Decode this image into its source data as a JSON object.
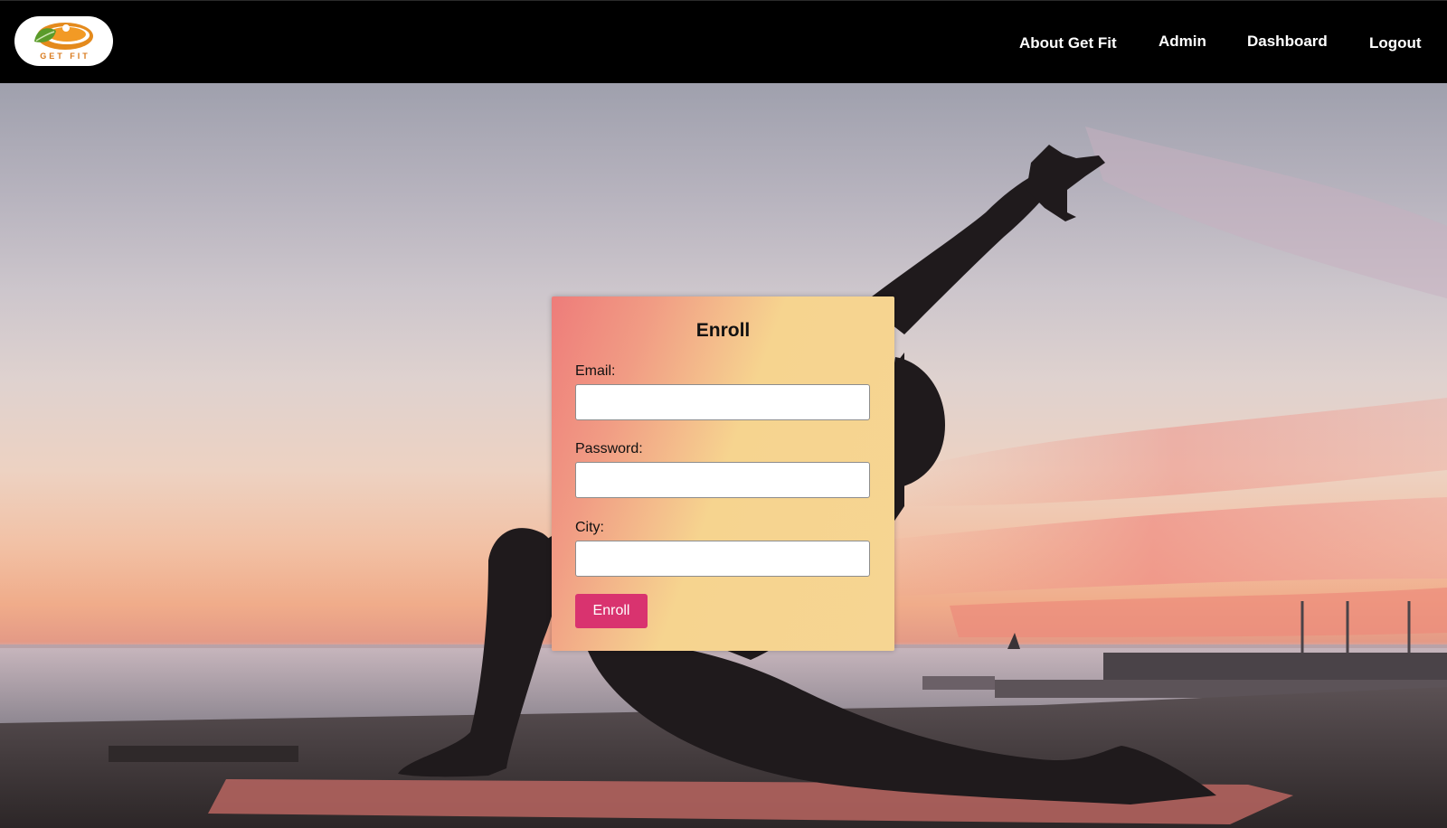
{
  "header": {
    "logo_text": "GET FIT",
    "nav": [
      {
        "label": "About Get Fit"
      },
      {
        "label": "Admin"
      },
      {
        "label": "Dashboard"
      },
      {
        "label": "Logout"
      }
    ]
  },
  "enroll_form": {
    "title": "Enroll",
    "email_label": "Email:",
    "email_value": "",
    "password_label": "Password:",
    "password_value": "",
    "city_label": "City:",
    "city_value": "",
    "submit_label": "Enroll"
  },
  "colors": {
    "nav_bg": "#000000",
    "button": "#d9336f",
    "card_gradient_start": "#ee7c7a",
    "card_gradient_end": "#f6d592"
  },
  "icons": {
    "logo": "get-fit-leaf-logo",
    "hero": "yoga-silhouette-sunset"
  }
}
